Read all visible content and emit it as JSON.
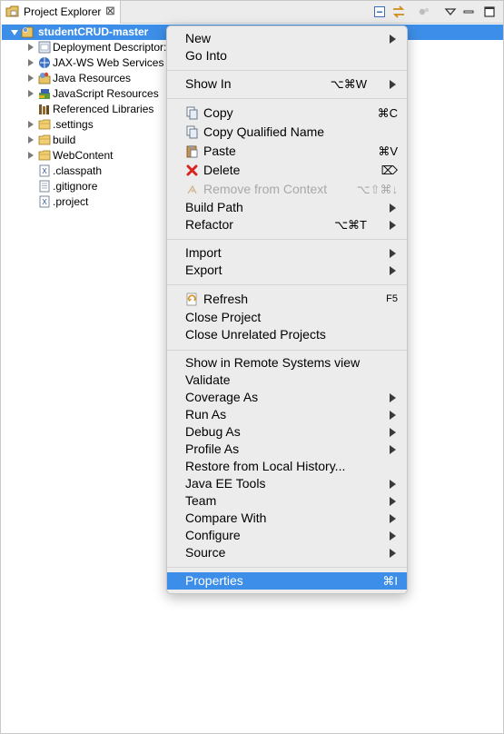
{
  "view": {
    "title": "Project Explorer",
    "close_glyph": "⊠"
  },
  "tree": {
    "root": "studentCRUD-master",
    "items": [
      {
        "label": "Deployment Descriptor:",
        "icon": "deployment-descriptor-icon"
      },
      {
        "label": "JAX-WS Web Services",
        "icon": "web-services-icon"
      },
      {
        "label": "Java Resources",
        "icon": "java-resources-icon"
      },
      {
        "label": "JavaScript Resources",
        "icon": "javascript-resources-icon"
      },
      {
        "label": "Referenced Libraries",
        "icon": "library-icon"
      },
      {
        "label": ".settings",
        "icon": "folder-icon"
      },
      {
        "label": "build",
        "icon": "folder-icon"
      },
      {
        "label": "WebContent",
        "icon": "folder-icon"
      },
      {
        "label": ".classpath",
        "icon": "xml-file-icon"
      },
      {
        "label": ".gitignore",
        "icon": "text-file-icon"
      },
      {
        "label": ".project",
        "icon": "xml-file-icon"
      }
    ]
  },
  "menu": {
    "new": {
      "label": "New"
    },
    "go_into": {
      "label": "Go Into"
    },
    "show_in": {
      "label": "Show In",
      "shortcut": "⌥⌘W"
    },
    "copy": {
      "label": "Copy",
      "shortcut": "⌘C"
    },
    "copy_qualified": {
      "label": "Copy Qualified Name"
    },
    "paste": {
      "label": "Paste",
      "shortcut": "⌘V"
    },
    "delete": {
      "label": "Delete",
      "shortcut": "⌦"
    },
    "remove_context": {
      "label": "Remove from Context",
      "shortcut": "⌥⇧⌘↓"
    },
    "build_path": {
      "label": "Build Path"
    },
    "refactor": {
      "label": "Refactor",
      "shortcut": "⌥⌘T"
    },
    "import": {
      "label": "Import"
    },
    "export": {
      "label": "Export"
    },
    "refresh": {
      "label": "Refresh",
      "shortcut": "F5"
    },
    "close_project": {
      "label": "Close Project"
    },
    "close_unrelated": {
      "label": "Close Unrelated Projects"
    },
    "show_remote": {
      "label": "Show in Remote Systems view"
    },
    "validate": {
      "label": "Validate"
    },
    "coverage_as": {
      "label": "Coverage As"
    },
    "run_as": {
      "label": "Run As"
    },
    "debug_as": {
      "label": "Debug As"
    },
    "profile_as": {
      "label": "Profile As"
    },
    "restore_history": {
      "label": "Restore from Local History..."
    },
    "javaee_tools": {
      "label": "Java EE Tools"
    },
    "team": {
      "label": "Team"
    },
    "compare_with": {
      "label": "Compare With"
    },
    "configure": {
      "label": "Configure"
    },
    "source": {
      "label": "Source"
    },
    "properties": {
      "label": "Properties",
      "shortcut": "⌘I"
    }
  },
  "colors": {
    "selection": "#3d8ee8",
    "menu_bg": "#ececec"
  }
}
